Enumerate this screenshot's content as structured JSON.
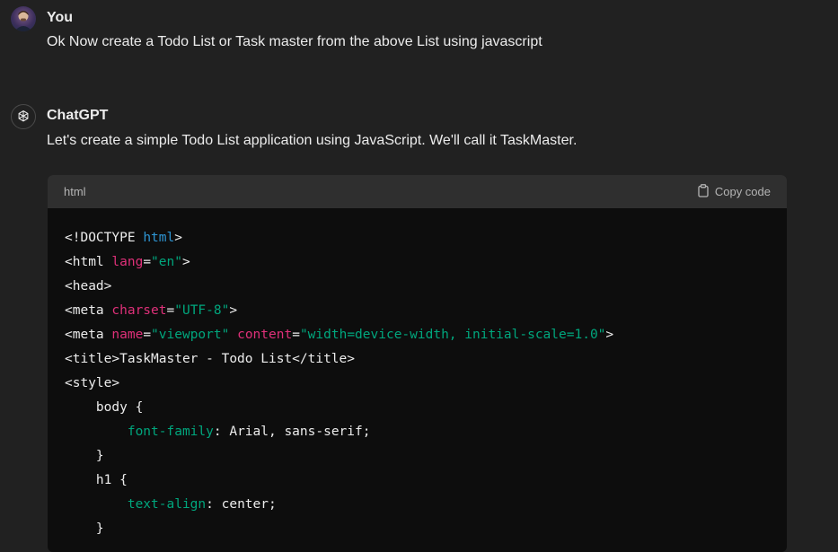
{
  "user_message": {
    "author": "You",
    "text": "Ok Now create a Todo List or Task master from the above List using javascript"
  },
  "assistant_message": {
    "author": "ChatGPT",
    "text": "Let's create a simple Todo List application using JavaScript. We'll call it TaskMaster."
  },
  "code_block": {
    "language": "html",
    "copy_label": "Copy code",
    "lines": [
      [
        {
          "t": "<!DOCTYPE ",
          "c": "plain"
        },
        {
          "t": "html",
          "c": "kw"
        },
        {
          "t": ">",
          "c": "plain"
        }
      ],
      [
        {
          "t": "<html ",
          "c": "plain"
        },
        {
          "t": "lang",
          "c": "attr"
        },
        {
          "t": "=",
          "c": "plain"
        },
        {
          "t": "\"en\"",
          "c": "str"
        },
        {
          "t": ">",
          "c": "plain"
        }
      ],
      [
        {
          "t": "<head>",
          "c": "plain"
        }
      ],
      [
        {
          "t": "<meta ",
          "c": "plain"
        },
        {
          "t": "charset",
          "c": "attr"
        },
        {
          "t": "=",
          "c": "plain"
        },
        {
          "t": "\"UTF-8\"",
          "c": "str"
        },
        {
          "t": ">",
          "c": "plain"
        }
      ],
      [
        {
          "t": "<meta ",
          "c": "plain"
        },
        {
          "t": "name",
          "c": "attr"
        },
        {
          "t": "=",
          "c": "plain"
        },
        {
          "t": "\"viewport\"",
          "c": "str"
        },
        {
          "t": " ",
          "c": "plain"
        },
        {
          "t": "content",
          "c": "attr"
        },
        {
          "t": "=",
          "c": "plain"
        },
        {
          "t": "\"width=device-width, initial-scale=1.0\"",
          "c": "str"
        },
        {
          "t": ">",
          "c": "plain"
        }
      ],
      [
        {
          "t": "<title>TaskMaster - Todo List</title>",
          "c": "plain"
        }
      ],
      [
        {
          "t": "<style>",
          "c": "plain"
        }
      ],
      [
        {
          "t": "    body {",
          "c": "plain"
        }
      ],
      [
        {
          "t": "        ",
          "c": "plain"
        },
        {
          "t": "font-family",
          "c": "prop"
        },
        {
          "t": ": Arial, sans-serif;",
          "c": "plain"
        }
      ],
      [
        {
          "t": "    }",
          "c": "plain"
        }
      ],
      [
        {
          "t": "    h1 {",
          "c": "plain"
        }
      ],
      [
        {
          "t": "        ",
          "c": "plain"
        },
        {
          "t": "text-align",
          "c": "prop"
        },
        {
          "t": ": center;",
          "c": "plain"
        }
      ],
      [
        {
          "t": "    }",
          "c": "plain"
        }
      ]
    ]
  },
  "colors": {
    "background": "#212121",
    "code_background": "#0d0d0d",
    "code_header": "#2f2f2f",
    "keyword": "#2e95d3",
    "attribute": "#df3079",
    "string": "#00a67d"
  },
  "icons": {
    "user_avatar": "user-avatar",
    "assistant_avatar": "openai-logo-icon",
    "copy": "clipboard-icon"
  }
}
